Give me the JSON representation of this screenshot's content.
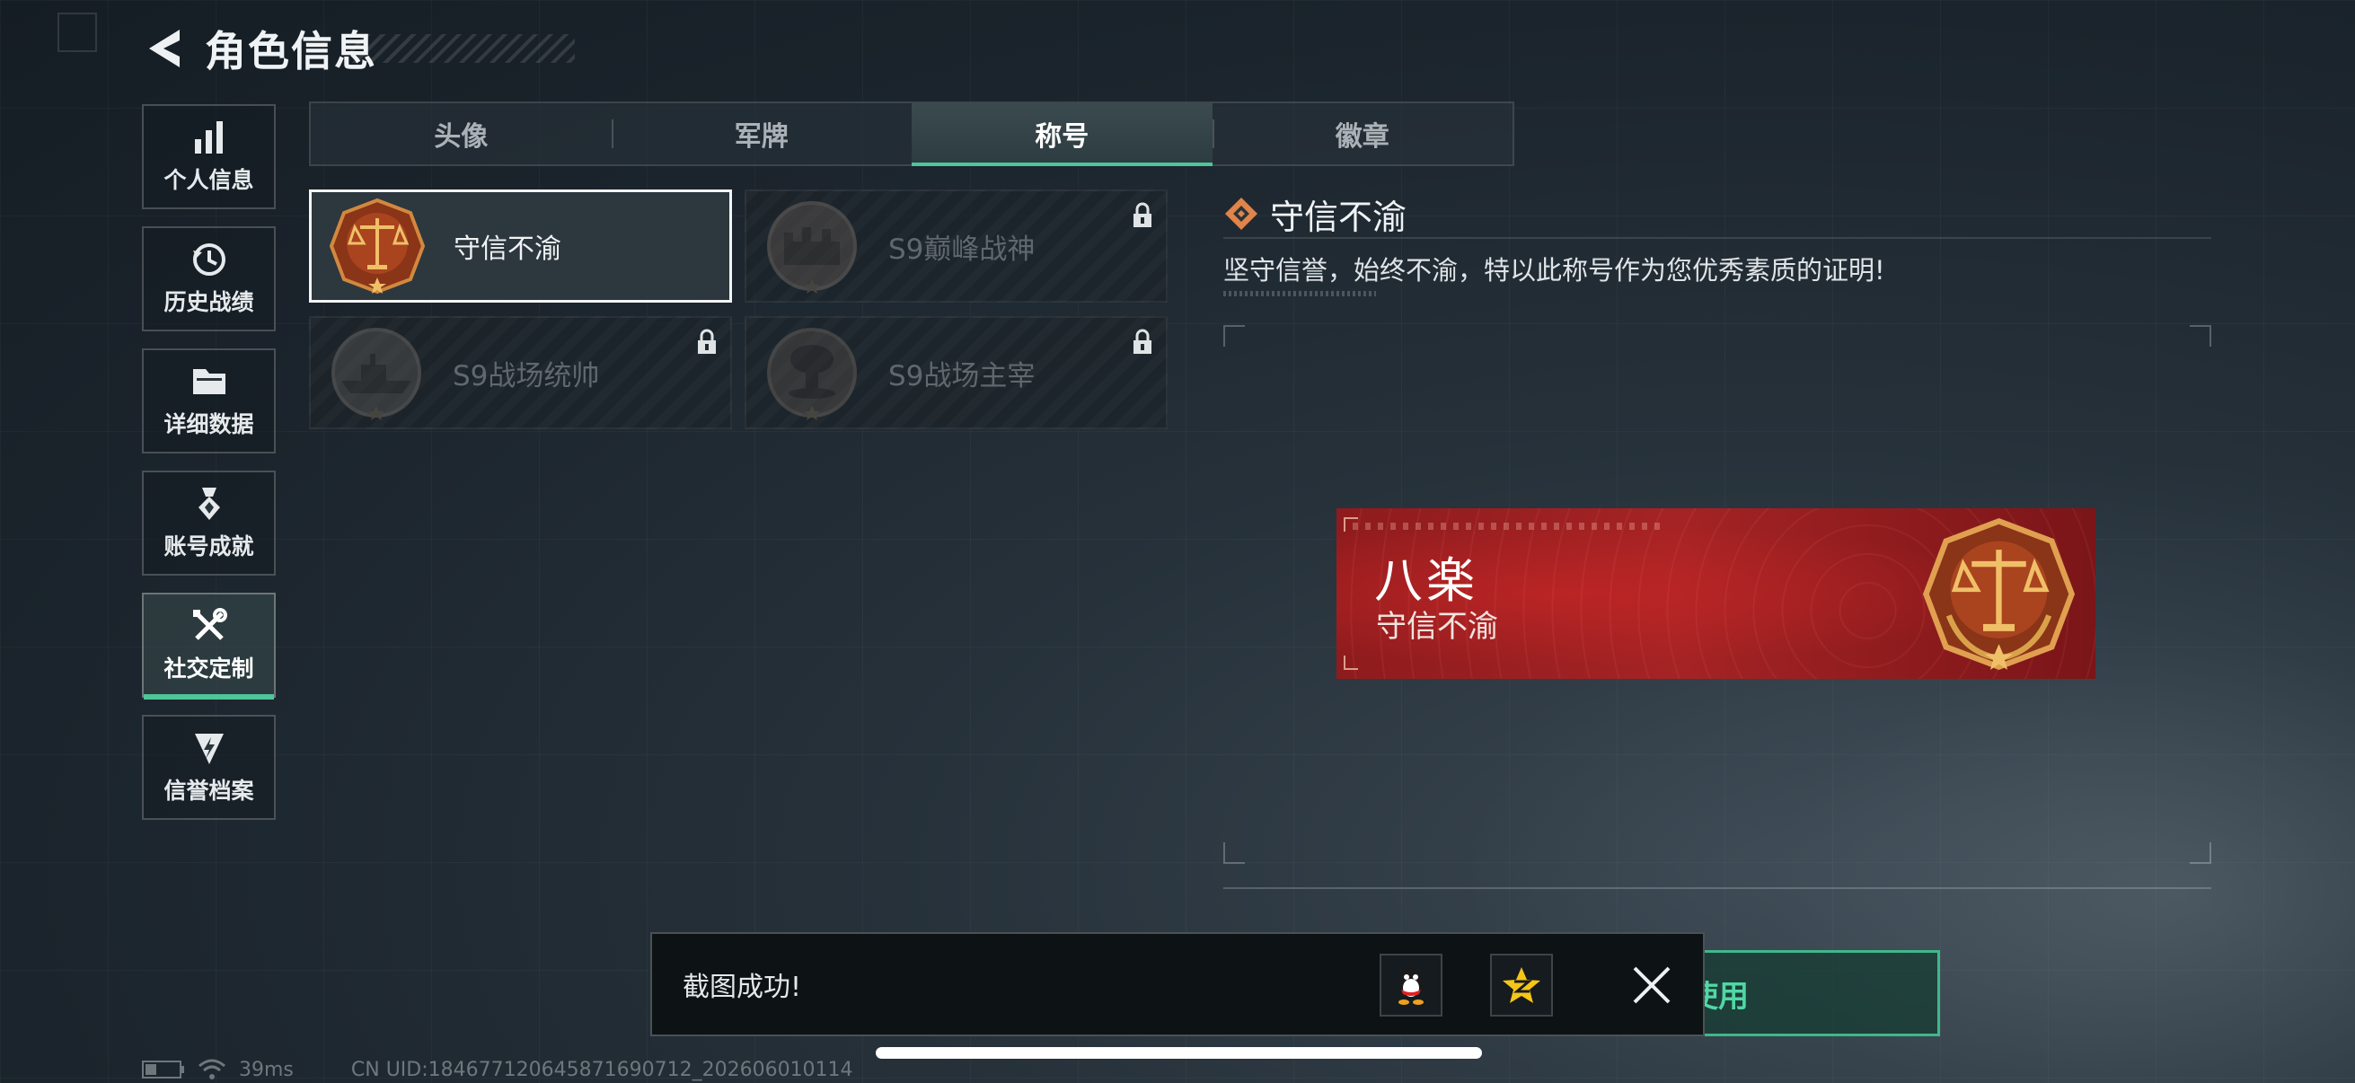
{
  "header": {
    "title": "角色信息"
  },
  "sidebar": {
    "items": [
      {
        "label": "个人信息",
        "icon": "bar-chart-icon",
        "active": false
      },
      {
        "label": "历史战绩",
        "icon": "history-clock-icon",
        "active": false
      },
      {
        "label": "详细数据",
        "icon": "folder-icon",
        "active": false
      },
      {
        "label": "账号成就",
        "icon": "medal-icon",
        "active": false
      },
      {
        "label": "社交定制",
        "icon": "wrench-screwdriver-icon",
        "active": true
      },
      {
        "label": "信誉档案",
        "icon": "shield-credit-icon",
        "active": false
      }
    ]
  },
  "tabs": [
    {
      "label": "头像",
      "active": false
    },
    {
      "label": "军牌",
      "active": false
    },
    {
      "label": "称号",
      "active": true
    },
    {
      "label": "徽章",
      "active": false
    }
  ],
  "titles": [
    {
      "name": "守信不渝",
      "locked": false,
      "selected": true,
      "emblem": "scales-emblem-icon"
    },
    {
      "name": "S9巅峰战神",
      "locked": true,
      "selected": false,
      "emblem": "fortress-emblem-icon"
    },
    {
      "name": "S9战场统帅",
      "locked": true,
      "selected": false,
      "emblem": "warship-emblem-icon"
    },
    {
      "name": "S9战场主宰",
      "locked": true,
      "selected": false,
      "emblem": "mushroom-cloud-emblem-icon"
    }
  ],
  "detail": {
    "name": "守信不渝",
    "description": "坚守信誉，始终不渝，特以此称号作为您优秀素质的证明!"
  },
  "nameplate": {
    "player_name": "八楽",
    "title": "守信不渝"
  },
  "use_button": {
    "label": "使用"
  },
  "toast": {
    "message": "截图成功!"
  },
  "status_bar": {
    "latency": "39ms",
    "uid": "CN UID:1846771206458716907​12_202606010114"
  },
  "colors": {
    "accent_green": "#4fc59a",
    "nameplate_red": "#a52324",
    "emblem_bronze": "#a0451f",
    "emblem_gold": "#e8b04a"
  }
}
